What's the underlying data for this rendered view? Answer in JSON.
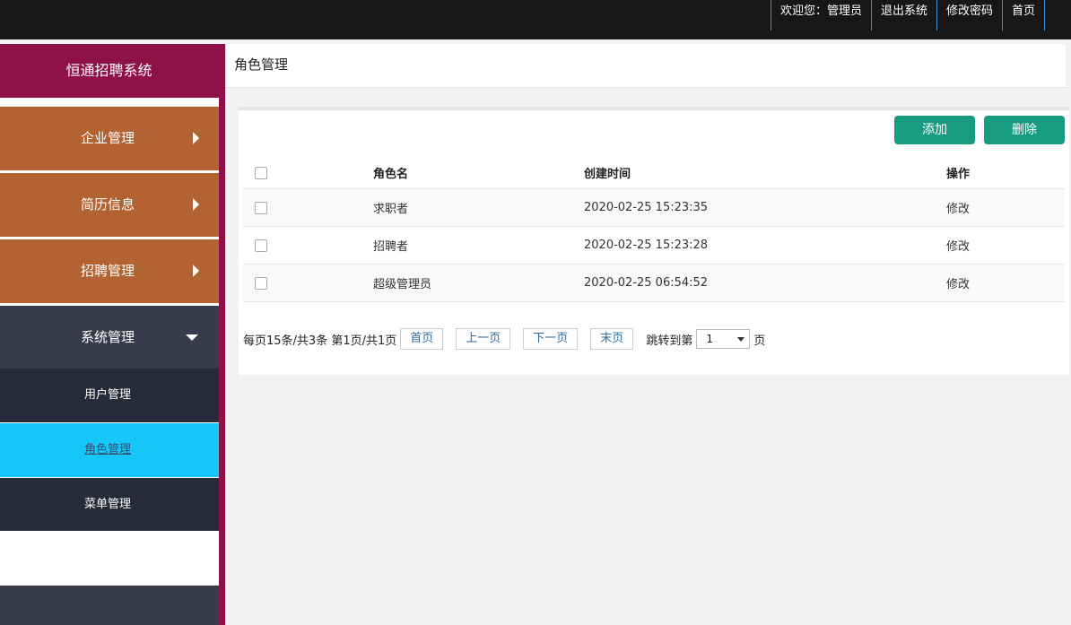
{
  "topnav": {
    "welcome": "欢迎您：管理员",
    "logout": "退出系统",
    "change_password": "修改密码",
    "home": "首页"
  },
  "sidebar": {
    "brand": "恒通招聘系统",
    "menus": [
      {
        "label": "企业管理",
        "icon": "caret-right-icon"
      },
      {
        "label": "简历信息",
        "icon": "caret-right-icon"
      },
      {
        "label": "招聘管理",
        "icon": "caret-right-icon"
      },
      {
        "label": "系统管理",
        "icon": "caret-down-icon",
        "expanded": true
      }
    ],
    "submenu": [
      {
        "label": "用户管理"
      },
      {
        "label": "角色管理",
        "active": true
      },
      {
        "label": "菜单管理"
      }
    ]
  },
  "page": {
    "title": "角色管理"
  },
  "toolbar": {
    "add_label": "添加",
    "delete_label": "删除"
  },
  "table": {
    "headers": [
      "角色名",
      "创建时间",
      "操作"
    ],
    "rows": [
      {
        "name": "求职者",
        "created": "2020-02-25 15:23:35",
        "action": "修改"
      },
      {
        "name": "招聘者",
        "created": "2020-02-25 15:23:28",
        "action": "修改"
      },
      {
        "name": "超级管理员",
        "created": "2020-02-25 06:54:52",
        "action": "修改"
      }
    ]
  },
  "pager": {
    "info": "每页15条/共3条 第1页/共1页",
    "first": "首页",
    "prev": "上一页",
    "next": "下一页",
    "last": "末页",
    "jump_label": "跳转到第",
    "jump_value": "1",
    "jump_unit": "页"
  },
  "colors": {
    "topbar": "#171717",
    "sidebar_brand": "#8e1148",
    "menu_collapsed": "#b36232",
    "menu_expanded": "#373b4c",
    "submenu": "#262a39",
    "submenu_active": "#17c7f9",
    "button": "#179b81"
  }
}
